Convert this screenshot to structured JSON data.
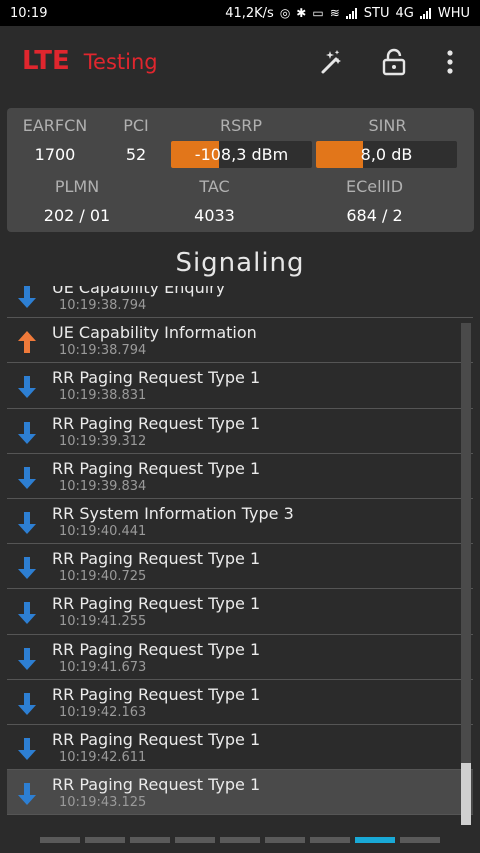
{
  "status_bar": {
    "time": "10:19",
    "speed": "41,2K/s",
    "carrier1": "STU",
    "network": "4G",
    "carrier2": "WHU"
  },
  "app": {
    "title_lte": "LTE",
    "title_testing": "Testing",
    "icons": [
      "magic-wand-icon",
      "unlock-icon",
      "more-vert-icon"
    ]
  },
  "cell": {
    "labels": {
      "earfcn": "EARFCN",
      "pci": "PCI",
      "rsrp": "RSRP",
      "sinr": "SINR",
      "plmn": "PLMN",
      "tac": "TAC",
      "ecellid": "ECellID"
    },
    "earfcn": "1700",
    "pci": "52",
    "rsrp": "-108,3 dBm",
    "rsrp_level": 0.34,
    "sinr": "8,0 dB",
    "sinr_level": 0.33,
    "plmn": "202 / 01",
    "tac": "4033",
    "ecellid": "684 / 2"
  },
  "section_title": "Signaling",
  "messages": [
    {
      "direction": "down",
      "name": "UE Capability Enquiry",
      "time": "10:19:38.794"
    },
    {
      "direction": "up",
      "name": "UE Capability Information",
      "time": "10:19:38.794"
    },
    {
      "direction": "down",
      "name": "RR Paging Request Type 1",
      "time": "10:19:38.831"
    },
    {
      "direction": "down",
      "name": "RR Paging Request Type 1",
      "time": "10:19:39.312"
    },
    {
      "direction": "down",
      "name": "RR Paging Request Type 1",
      "time": "10:19:39.834"
    },
    {
      "direction": "down",
      "name": "RR System Information Type 3",
      "time": "10:19:40.441"
    },
    {
      "direction": "down",
      "name": "RR Paging Request Type 1",
      "time": "10:19:40.725"
    },
    {
      "direction": "down",
      "name": "RR Paging Request Type 1",
      "time": "10:19:41.255"
    },
    {
      "direction": "down",
      "name": "RR Paging Request Type 1",
      "time": "10:19:41.673"
    },
    {
      "direction": "down",
      "name": "RR Paging Request Type 1",
      "time": "10:19:42.163"
    },
    {
      "direction": "down",
      "name": "RR Paging Request Type 1",
      "time": "10:19:42.611"
    },
    {
      "direction": "down",
      "name": "RR Paging Request Type 1",
      "time": "10:19:43.125",
      "selected": true
    }
  ],
  "colors": {
    "accent_red": "#e0262e",
    "bar_orange": "#e2761a",
    "down_arrow": "#2d7fd3",
    "up_arrow": "#f07a3a",
    "pager_active": "#19a9d6"
  },
  "pager": {
    "count": 9,
    "active_index": 7
  }
}
